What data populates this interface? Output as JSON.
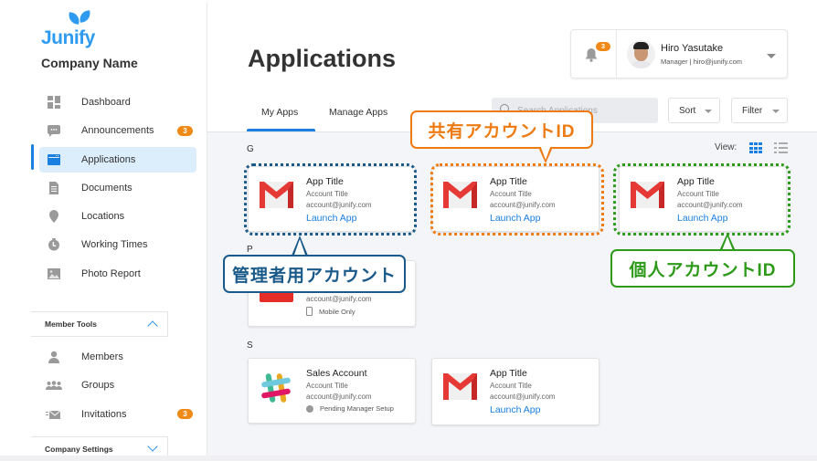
{
  "brand": {
    "logo_text": "Junify",
    "company_name": "Company Name",
    "accent": "#2e9bf0"
  },
  "sidebar": {
    "items": [
      {
        "label": "Dashboard",
        "icon": "dashboard-icon"
      },
      {
        "label": "Announcements",
        "icon": "chat-bubble-icon",
        "badge": "3"
      },
      {
        "label": "Applications",
        "icon": "browser-window-icon",
        "active": true
      },
      {
        "label": "Documents",
        "icon": "document-icon"
      },
      {
        "label": "Locations",
        "icon": "map-pin-icon"
      },
      {
        "label": "Working Times",
        "icon": "clock-icon"
      },
      {
        "label": "Photo Report",
        "icon": "image-icon"
      }
    ],
    "member_tools": {
      "title": "Member Tools",
      "expanded": true,
      "items": [
        {
          "label": "Members",
          "icon": "person-icon"
        },
        {
          "label": "Groups",
          "icon": "group-icon"
        },
        {
          "label": "Invitations",
          "icon": "envelope-icon",
          "badge": "3"
        }
      ]
    },
    "company_settings": {
      "title": "Company Settings",
      "expanded": false
    }
  },
  "header": {
    "page_title": "Applications",
    "notifications_badge": "3",
    "user": {
      "name": "Hiro Yasutake",
      "subtitle": "Manager | hiro@junify.com"
    }
  },
  "tabs": [
    {
      "label": "My Apps",
      "active": true
    },
    {
      "label": "Manage Apps",
      "active": false
    }
  ],
  "toolbar": {
    "search_placeholder": "Search Applications",
    "sort_label": "Sort",
    "filter_label": "Filter",
    "view_label": "View:",
    "view_mode": "grid"
  },
  "groups": [
    {
      "letter": "G",
      "cards": [
        {
          "icon": "gmail-icon",
          "title": "App Title",
          "account": "Account Title",
          "email": "account@junify.com",
          "action": "Launch App"
        },
        {
          "icon": "gmail-icon",
          "title": "App Title",
          "account": "Account Title",
          "email": "account@junify.com",
          "action": "Launch App"
        },
        {
          "icon": "gmail-icon",
          "title": "App Title",
          "account": "Account Title",
          "email": "account@junify.com",
          "action": "Launch App"
        }
      ]
    },
    {
      "letter": "P",
      "cards": [
        {
          "icon": "red-app-icon",
          "title": "",
          "account": "",
          "email": "account@junify.com",
          "status": "Mobile Only"
        }
      ]
    },
    {
      "letter": "S",
      "cards": [
        {
          "icon": "slack-icon",
          "title": "Sales Account",
          "account": "Account Title",
          "email": "account@junify.com",
          "status": "Pending Manager Setup"
        },
        {
          "icon": "gmail-icon",
          "title": "App Title",
          "account": "Account Title",
          "email": "account@junify.com",
          "action": "Launch App"
        }
      ]
    }
  ],
  "annotations": [
    {
      "label": "管理者用アカウント",
      "color": "#1a5a8a"
    },
    {
      "label": "共有アカウントID",
      "color": "#ee7a12"
    },
    {
      "label": "個人アカウントID",
      "color": "#2e9a1a"
    }
  ]
}
